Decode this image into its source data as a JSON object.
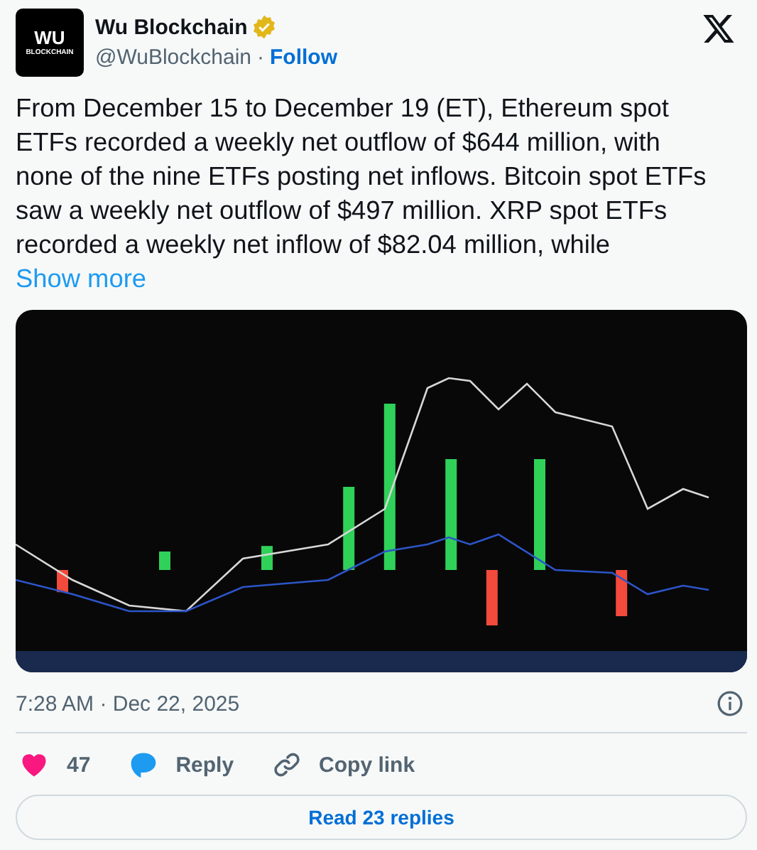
{
  "author": {
    "avatar_top": "WU",
    "avatar_bottom": "BLOCKCHAIN",
    "name": "Wu Blockchain",
    "verified": true,
    "handle": "@WuBlockchain",
    "separator": "·",
    "follow": "Follow"
  },
  "post": {
    "text": "From December 15 to December 19 (ET), Ethereum spot ETFs recorded a weekly net outflow of $644 million, with none of the nine ETFs posting net inflows. Bitcoin spot ETFs saw a weekly net outflow of $497 million. XRP spot ETFs recorded a weekly net inflow of $82.04 million, while",
    "show_more": "Show more"
  },
  "timestamp": "7:28 AM · Dec 22, 2025",
  "actions": {
    "likes": "47",
    "reply": "Reply",
    "copy_link": "Copy link"
  },
  "read_replies": "Read 23 replies"
}
